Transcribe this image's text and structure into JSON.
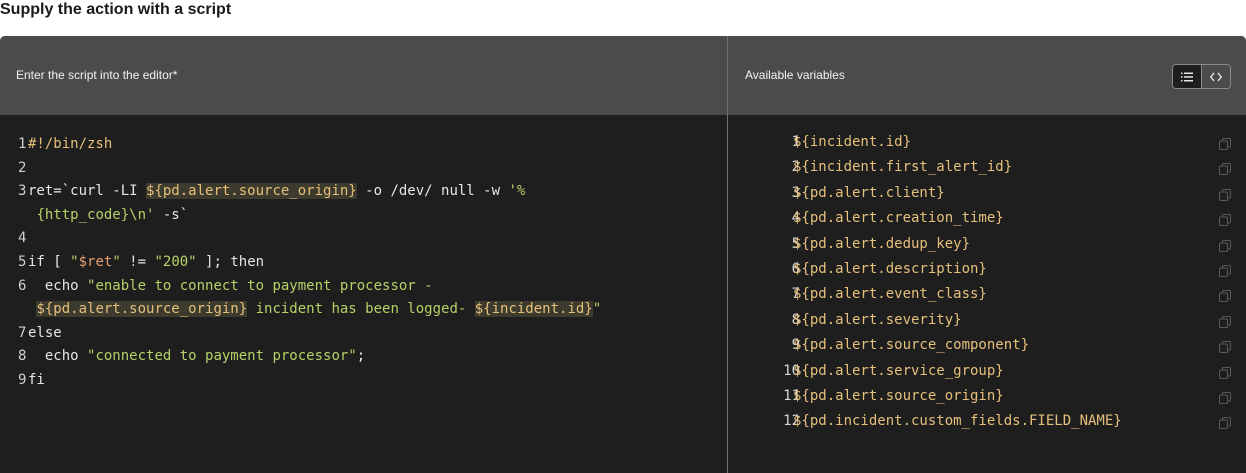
{
  "page_title": "Supply the action with a script",
  "editor": {
    "label": "Enter the script into the editor*",
    "lines": [
      {
        "num": "1",
        "parts": [
          {
            "t": "#!/bin/zsh",
            "c": "shebang"
          }
        ]
      },
      {
        "num": "2",
        "parts": []
      },
      {
        "num": "3",
        "parts": [
          {
            "t": "ret=`curl -LI ",
            "c": ""
          },
          {
            "t": "${pd.alert.source_origin}",
            "c": "hl"
          },
          {
            "t": " -o /dev/ null -w ",
            "c": ""
          },
          {
            "t": "'%",
            "c": "str"
          }
        ]
      },
      {
        "num": "",
        "parts": [
          {
            "t": "{http_code}\\n'",
            "c": "str"
          },
          {
            "t": " -s`",
            "c": ""
          }
        ]
      },
      {
        "num": "4",
        "parts": []
      },
      {
        "num": "5",
        "parts": [
          {
            "t": "if [ ",
            "c": ""
          },
          {
            "t": "\"",
            "c": "str"
          },
          {
            "t": "$ret",
            "c": "strvar"
          },
          {
            "t": "\"",
            "c": "str"
          },
          {
            "t": " != ",
            "c": ""
          },
          {
            "t": "\"200\"",
            "c": "str"
          },
          {
            "t": " ]; then",
            "c": ""
          }
        ]
      },
      {
        "num": "6",
        "parts": [
          {
            "t": "  echo ",
            "c": ""
          },
          {
            "t": "\"enable to connect to payment processor -",
            "c": "str"
          }
        ]
      },
      {
        "num": "",
        "parts": [
          {
            "t": "${pd.alert.source_origin}",
            "c": "hl"
          },
          {
            "t": " incident has been logged- ",
            "c": "str"
          },
          {
            "t": "${incident.id}",
            "c": "hl"
          },
          {
            "t": "\"",
            "c": "str"
          }
        ]
      },
      {
        "num": "7",
        "parts": [
          {
            "t": "else",
            "c": ""
          }
        ]
      },
      {
        "num": "8",
        "parts": [
          {
            "t": "  echo ",
            "c": ""
          },
          {
            "t": "\"connected to payment processor\"",
            "c": "str"
          },
          {
            "t": ";",
            "c": ""
          }
        ]
      },
      {
        "num": "9",
        "parts": [
          {
            "t": "fi",
            "c": ""
          }
        ]
      }
    ]
  },
  "variables_panel": {
    "label": "Available variables",
    "view_toggle": {
      "list_icon": "list-icon",
      "code_icon": "code-brackets-icon",
      "active": "list"
    },
    "items": [
      {
        "num": "1",
        "name": "${incident.id}"
      },
      {
        "num": "2",
        "name": "${incident.first_alert_id}"
      },
      {
        "num": "3",
        "name": "${pd.alert.client}"
      },
      {
        "num": "4",
        "name": "${pd.alert.creation_time}"
      },
      {
        "num": "5",
        "name": "${pd.alert.dedup_key}"
      },
      {
        "num": "6",
        "name": "${pd.alert.description}"
      },
      {
        "num": "7",
        "name": "${pd.alert.event_class}"
      },
      {
        "num": "8",
        "name": "${pd.alert.severity}"
      },
      {
        "num": "9",
        "name": "${pd.alert.source_component}"
      },
      {
        "num": "10",
        "name": "${pd.alert.service_group}"
      },
      {
        "num": "11",
        "name": "${pd.alert.source_origin}"
      },
      {
        "num": "12",
        "name": "${pd.incident.custom_fields.FIELD_NAME}"
      }
    ],
    "copy_icon": "copy-icon"
  },
  "colors": {
    "header_bg": "#4b4b4b",
    "editor_bg": "#1e1e1e",
    "string": "#b5d267",
    "variable": "#e5c07b"
  }
}
